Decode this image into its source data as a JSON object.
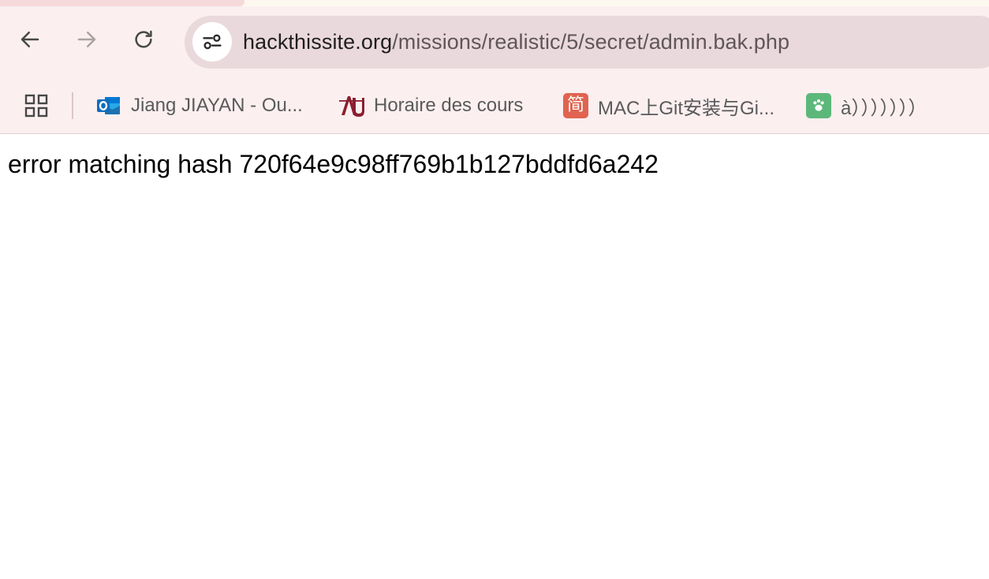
{
  "browser": {
    "address_bar": {
      "host": "hackthissite.org",
      "path": "/missions/realistic/5/secret/admin.bak.php",
      "site_info_icon": "tune-icon"
    },
    "nav": {
      "back_icon": "arrow-left-icon",
      "forward_icon": "arrow-right-icon",
      "reload_icon": "reload-icon"
    },
    "bookmarks": {
      "apps_icon": "apps-grid-icon",
      "items": [
        {
          "label": "Jiang JIAYAN - Ou...",
          "icon": "outlook-icon",
          "color": "#0f6cbd"
        },
        {
          "label": "Horaire des cours",
          "icon": "university-logo-icon",
          "color": "#8b1e2f"
        },
        {
          "label": "MAC上Git安装与Gi...",
          "icon": "jianshu-icon",
          "icon_text": "简",
          "color": "#e0644f"
        },
        {
          "label": "à）））））））",
          "icon": "green-app-icon",
          "color": "#5cb87a"
        }
      ]
    }
  },
  "page": {
    "message": "error matching hash 720f64e9c98ff769b1b127bddfd6a242"
  }
}
